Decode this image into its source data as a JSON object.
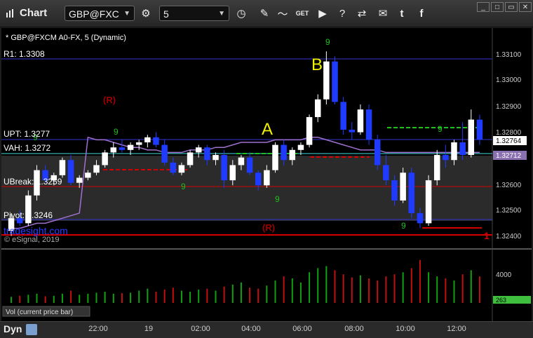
{
  "app": {
    "title": "Chart"
  },
  "toolbar": {
    "symbol": "GBP@FXC",
    "interval": "5",
    "icons": [
      "settings-gear-icon",
      "clock-icon",
      "pencil-icon",
      "indicator-icon",
      "get-icon",
      "play-icon",
      "question-icon",
      "link-icon",
      "comment-icon",
      "twitter-icon",
      "facebook-icon"
    ]
  },
  "chart": {
    "header": "* GBP@FXCM A0-FX, 5 (Dynamic)",
    "levels": {
      "r1": "R1: 1.3308",
      "upt": "UPT: 1.3277",
      "vah": "VAH: 1.3272",
      "ubreak": "UBreak: 1.3259",
      "pivot": "Pivot: 1.3246"
    },
    "markers": {
      "a": "A",
      "b": "B",
      "r_top": "(R)",
      "r_bottom": "(R)",
      "edge_one": "1"
    },
    "price_axis": [
      "1.33100",
      "1.33000",
      "1.32900",
      "1.32800",
      "1.32600",
      "1.32500",
      "1.32400"
    ],
    "price_tag_last": "1.32764",
    "price_tag_vwap": "1.32712",
    "watermark_site": "tradesight.com",
    "copyright": "© eSignal, 2019",
    "demark_counts": [
      "9",
      "9",
      "9",
      "9",
      "9",
      "9",
      "9"
    ]
  },
  "volume_panel": {
    "label": "Vol (current price bar)",
    "axis_label": "4000",
    "last_value": "263"
  },
  "time_axis": [
    "22:00",
    "19",
    "02:00",
    "04:00",
    "06:00",
    "08:00",
    "10:00",
    "12:00"
  ],
  "bottom": {
    "mode": "Dyn"
  },
  "colors": {
    "up_candle": "#ffffff",
    "down_candle": "#1f3bff",
    "level_red": "#d40000",
    "level_blue": "#3333cc",
    "level_cyan": "#40e0e0",
    "vwap": "#a070d0",
    "demark_green": "#1ec01e",
    "marker_yellow": "#f0f000",
    "volume_red": "#c01010",
    "volume_green": "#10a010"
  },
  "chart_data": {
    "type": "candlestick",
    "ylim": [
      1.3237,
      1.3313
    ],
    "candles": [
      [
        1.324,
        1.3247,
        1.3238,
        1.3245
      ],
      [
        1.3245,
        1.3248,
        1.3242,
        1.3243
      ],
      [
        1.3243,
        1.3256,
        1.3242,
        1.3254
      ],
      [
        1.3254,
        1.3266,
        1.3252,
        1.3264
      ],
      [
        1.3264,
        1.3266,
        1.3259,
        1.326
      ],
      [
        1.326,
        1.3263,
        1.3258,
        1.3262
      ],
      [
        1.3262,
        1.3269,
        1.3261,
        1.3268
      ],
      [
        1.3268,
        1.327,
        1.3258,
        1.3259
      ],
      [
        1.3259,
        1.3262,
        1.3257,
        1.3261
      ],
      [
        1.3261,
        1.3264,
        1.326,
        1.3263
      ],
      [
        1.3263,
        1.3268,
        1.3262,
        1.3266
      ],
      [
        1.3266,
        1.3272,
        1.3265,
        1.3271
      ],
      [
        1.3271,
        1.3275,
        1.3269,
        1.3273
      ],
      [
        1.3273,
        1.3276,
        1.3271,
        1.3272
      ],
      [
        1.3272,
        1.3275,
        1.327,
        1.3274
      ],
      [
        1.3274,
        1.3276,
        1.3272,
        1.3275
      ],
      [
        1.3275,
        1.3278,
        1.3273,
        1.3277
      ],
      [
        1.3277,
        1.3279,
        1.3273,
        1.3274
      ],
      [
        1.3274,
        1.3276,
        1.3266,
        1.3267
      ],
      [
        1.3267,
        1.3269,
        1.3262,
        1.3263
      ],
      [
        1.3263,
        1.3267,
        1.3262,
        1.3266
      ],
      [
        1.3266,
        1.3272,
        1.3265,
        1.3271
      ],
      [
        1.3271,
        1.3274,
        1.3269,
        1.3273
      ],
      [
        1.3273,
        1.3274,
        1.3266,
        1.3268
      ],
      [
        1.3268,
        1.3271,
        1.3266,
        1.327
      ],
      [
        1.327,
        1.3272,
        1.3257,
        1.326
      ],
      [
        1.326,
        1.3268,
        1.3258,
        1.3266
      ],
      [
        1.3266,
        1.327,
        1.3264,
        1.3269
      ],
      [
        1.3269,
        1.3271,
        1.3262,
        1.3263
      ],
      [
        1.3263,
        1.3264,
        1.3256,
        1.3258
      ],
      [
        1.3258,
        1.3266,
        1.3257,
        1.3264
      ],
      [
        1.3264,
        1.3275,
        1.3263,
        1.3274
      ],
      [
        1.3274,
        1.3276,
        1.3266,
        1.3268
      ],
      [
        1.3268,
        1.3273,
        1.3266,
        1.3272
      ],
      [
        1.3272,
        1.3275,
        1.327,
        1.3274
      ],
      [
        1.3274,
        1.3286,
        1.3273,
        1.3285
      ],
      [
        1.3285,
        1.3294,
        1.3283,
        1.3292
      ],
      [
        1.3292,
        1.3311,
        1.329,
        1.3307
      ],
      [
        1.3307,
        1.3309,
        1.329,
        1.3291
      ],
      [
        1.3291,
        1.3293,
        1.3278,
        1.328
      ],
      [
        1.328,
        1.3283,
        1.3276,
        1.3279
      ],
      [
        1.3279,
        1.329,
        1.3278,
        1.3288
      ],
      [
        1.3288,
        1.329,
        1.3274,
        1.3276
      ],
      [
        1.3276,
        1.3278,
        1.3264,
        1.3266
      ],
      [
        1.3266,
        1.327,
        1.3258,
        1.326
      ],
      [
        1.326,
        1.3262,
        1.325,
        1.3252
      ],
      [
        1.3252,
        1.3265,
        1.3251,
        1.3263
      ],
      [
        1.3263,
        1.3265,
        1.3245,
        1.3247
      ],
      [
        1.3247,
        1.3249,
        1.3241,
        1.3243
      ],
      [
        1.3243,
        1.3262,
        1.3242,
        1.326
      ],
      [
        1.326,
        1.3272,
        1.3258,
        1.327
      ],
      [
        1.327,
        1.3274,
        1.3265,
        1.3268
      ],
      [
        1.3268,
        1.3276,
        1.3266,
        1.3275
      ],
      [
        1.3275,
        1.3283,
        1.3268,
        1.327
      ],
      [
        1.327,
        1.3288,
        1.3269,
        1.3284
      ],
      [
        1.3284,
        1.3286,
        1.3274,
        1.3276
      ]
    ],
    "vwap": [
      1.3241,
      1.3241,
      1.3242,
      1.3243,
      1.3243,
      1.3244,
      1.3245,
      1.3246,
      1.3247,
      1.3277,
      1.3276,
      1.3276,
      1.3275,
      1.3274,
      1.3273,
      1.3273,
      1.3272,
      1.3272,
      1.3271,
      1.3271,
      1.3271,
      1.3272,
      1.3272,
      1.3272,
      1.3273,
      1.3273,
      1.3274,
      1.3275,
      1.3275,
      1.3275,
      1.3275,
      1.3276,
      1.3276,
      1.3276,
      1.3276,
      1.3277,
      1.3277,
      1.3276,
      1.3275,
      1.3274,
      1.3273,
      1.3272,
      1.3272,
      1.3272,
      1.3271,
      1.3271,
      1.3271,
      1.3271,
      1.3271,
      1.3271,
      1.3271,
      1.3271,
      1.3271,
      1.3271,
      1.3271,
      1.3271
    ],
    "volume": [
      600,
      700,
      800,
      900,
      650,
      700,
      900,
      1200,
      800,
      900,
      1000,
      1100,
      900,
      950,
      1000,
      1200,
      1400,
      1100,
      1300,
      1500,
      1200,
      1100,
      1300,
      1400,
      1200,
      1600,
      1800,
      2000,
      1500,
      1400,
      1700,
      2200,
      2600,
      2400,
      2000,
      3000,
      3400,
      3600,
      3200,
      2800,
      2500,
      2700,
      2400,
      2200,
      2600,
      2800,
      3000,
      3400,
      4200,
      3000,
      2600,
      2400,
      2200,
      2800,
      3200,
      2600
    ],
    "volume_up": [
      true,
      false,
      true,
      true,
      false,
      true,
      true,
      false,
      true,
      true,
      true,
      true,
      true,
      false,
      true,
      true,
      true,
      false,
      false,
      false,
      true,
      true,
      true,
      false,
      true,
      false,
      true,
      true,
      false,
      false,
      true,
      true,
      false,
      true,
      true,
      true,
      true,
      true,
      false,
      false,
      false,
      true,
      false,
      false,
      false,
      false,
      true,
      false,
      false,
      true,
      true,
      false,
      true,
      false,
      true,
      false
    ],
    "vol_max": 4800
  }
}
